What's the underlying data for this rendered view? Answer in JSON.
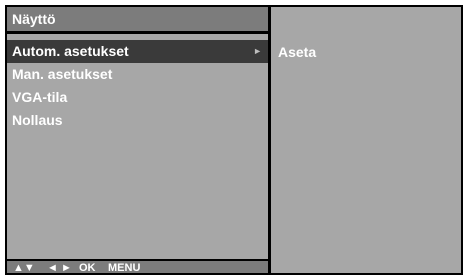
{
  "menu": {
    "title": "Näyttö",
    "items": [
      {
        "label": "Autom. asetukset",
        "selected": true,
        "has_submenu": true
      },
      {
        "label": "Man. asetukset",
        "selected": false
      },
      {
        "label": "VGA-tila",
        "selected": false
      },
      {
        "label": "Nollaus",
        "selected": false
      }
    ],
    "submenu_arrow": "►"
  },
  "submenu": {
    "items": [
      {
        "label": "Aseta"
      }
    ]
  },
  "footer": {
    "updown": "▲▼",
    "leftright": "◄ ►",
    "ok": "OK",
    "menu": "MENU"
  },
  "colors": {
    "panel": "#a7a7a7",
    "title_bar": "#7c7c7c",
    "selected": "#3a3a3a",
    "border": "#000000",
    "text": "#ffffff"
  }
}
